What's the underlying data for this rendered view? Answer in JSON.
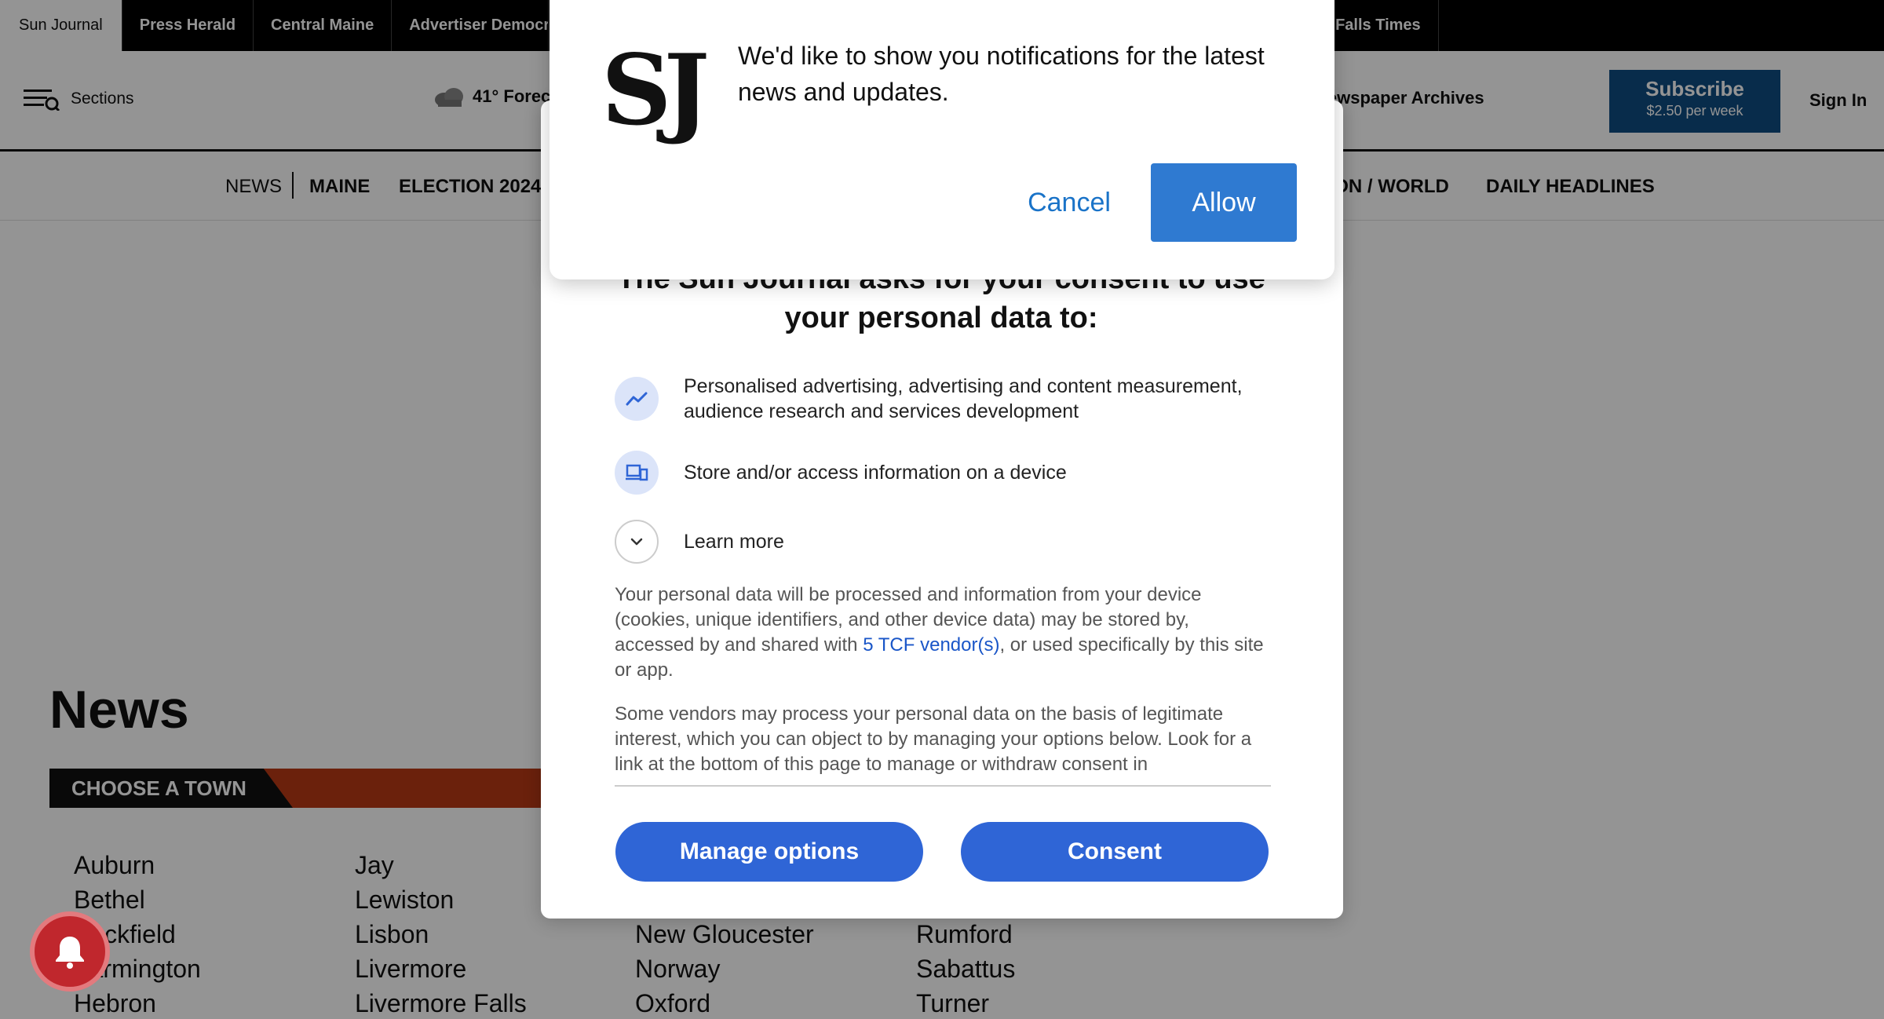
{
  "topbar": {
    "sites": [
      "Sun Journal",
      "Press Herald",
      "Central Maine",
      "Advertiser Democrat",
      "Rumford Falls Times"
    ]
  },
  "header": {
    "sections_label": "Sections",
    "weather": "41°  Forecast",
    "archives": "Newspaper Archives",
    "subscribe_title": "Subscribe",
    "subscribe_price": "$2.50 per week",
    "sign_in": "Sign In"
  },
  "nav": {
    "items": [
      "NEWS",
      "MAINE",
      "ELECTION 2024",
      "NATION / WORLD",
      "DAILY HEADLINES"
    ]
  },
  "page": {
    "news_title": "News",
    "choose_town": "CHOOSE A TOWN",
    "towns": [
      "Auburn",
      "Bethel",
      "Buckfield",
      "Farmington",
      "Hebron",
      "Jay",
      "Lewiston",
      "Lisbon",
      "Livermore",
      "Livermore Falls",
      "New Gloucester",
      "Norway",
      "Oxford",
      "Rumford",
      "Sabattus",
      "Turner"
    ]
  },
  "consent": {
    "heading_line1": "The Sun Journal asks for your consent to use",
    "heading_line2": "your personal data to:",
    "purposes": [
      {
        "icon": "trend-line-icon",
        "text": "Personalised advertising, advertising and content measurement, audience research and services development"
      },
      {
        "icon": "devices-icon",
        "text": "Store and/or access information on a device"
      }
    ],
    "learn_more": "Learn more",
    "para1_before": "Your personal data will be processed and information from your device (cookies, unique identifiers, and other device data) may be stored by, accessed by and shared with ",
    "para1_link": "5 TCF vendor(s)",
    "para1_after": ", or used specifically by this site or app.",
    "para2": "Some vendors may process your personal data on the basis of legitimate interest, which you can object to by managing your options below. Look for a link at the bottom of this page to manage or withdraw consent in",
    "manage_options": "Manage options",
    "consent_button": "Consent",
    "accent_color": "#2f65d6"
  },
  "notification": {
    "logo": "SJ",
    "message": "We'd like to show you notifications for the latest news and updates.",
    "cancel": "Cancel",
    "allow": "Allow",
    "allow_color": "#2f7ad1"
  }
}
